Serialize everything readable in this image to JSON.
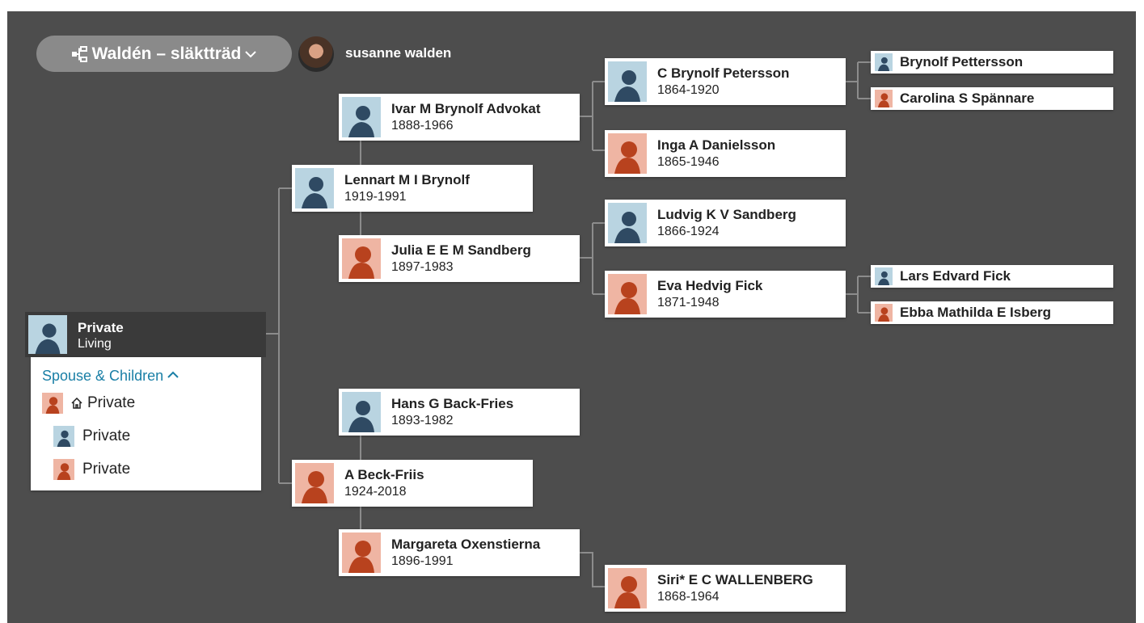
{
  "header": {
    "tree_name": "Waldén – släktträd",
    "user_name": "susanne walden"
  },
  "home_person": {
    "name": "Private",
    "status": "Living",
    "gender": "male"
  },
  "spouse_panel": {
    "title": "Spouse & Children",
    "spouse": {
      "name": "Private",
      "gender": "female"
    },
    "children": [
      {
        "name": "Private",
        "gender": "male"
      },
      {
        "name": "Private",
        "gender": "female"
      }
    ]
  },
  "people": {
    "lennart": {
      "name": "Lennart M I Brynolf",
      "years": "1919-1991",
      "gender": "male"
    },
    "abeck": {
      "name": "A Beck-Friis",
      "years": "1924-2018",
      "gender": "female"
    },
    "ivar": {
      "name": "Ivar M Brynolf Advokat",
      "years": "1888-1966",
      "gender": "male"
    },
    "julia": {
      "name": "Julia E E M Sandberg",
      "years": "1897-1983",
      "gender": "female"
    },
    "hans": {
      "name": "Hans G Back-Fries",
      "years": "1893-1982",
      "gender": "male"
    },
    "margareta": {
      "name": "Margareta Oxenstierna",
      "years": "1896-1991",
      "gender": "female"
    },
    "cbrynolf": {
      "name": "C Brynolf Petersson",
      "years": "1864-1920",
      "gender": "male"
    },
    "inga": {
      "name": "Inga A Danielsson",
      "years": "1865-1946",
      "gender": "female"
    },
    "ludvig": {
      "name": "Ludvig K V Sandberg",
      "years": "1866-1924",
      "gender": "male"
    },
    "eva": {
      "name": "Eva Hedvig Fick",
      "years": "1871-1948",
      "gender": "female"
    },
    "siri": {
      "name": "Siri* E C WALLENBERG",
      "years": "1868-1964",
      "gender": "female"
    },
    "brynolf": {
      "name": "Brynolf Pettersson",
      "gender": "male"
    },
    "carolina": {
      "name": "Carolina S Spännare",
      "gender": "female"
    },
    "lars": {
      "name": "Lars Edvard Fick",
      "gender": "male"
    },
    "ebba": {
      "name": "Ebba Mathilda E Isberg",
      "gender": "female"
    }
  },
  "colors": {
    "background": "#4d4d4d",
    "male_bg": "#b9d4e1",
    "male_figure": "#2f4a63",
    "female_bg": "#efb5a3",
    "female_figure": "#b8421e",
    "link": "#1a7fa6"
  },
  "icons": {
    "tree": "tree-view-icon",
    "chevron": "chevron-down-icon",
    "home": "home-icon",
    "expand": "chevron-up-icon"
  }
}
